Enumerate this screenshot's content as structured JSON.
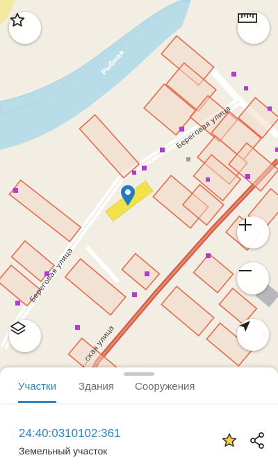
{
  "map": {
    "river_name": "Рыбная",
    "street_labels": [
      "Береговая улица",
      "Береговая улица",
      "…ская улица"
    ],
    "colors": {
      "background": "#f3eee4",
      "river": "#b8dde9",
      "parcel_stroke": "#e86a4d",
      "parcel_fill": "#f2d6c4",
      "selected_parcel": "#f1e24a",
      "building_marker": "#b43bd0",
      "pin": "#1f7ec2"
    }
  },
  "controls": {
    "favorite_icon": "star-icon",
    "ruler_icon": "ruler-icon",
    "zoom_in_icon": "plus-icon",
    "zoom_out_icon": "minus-icon",
    "layers_icon": "layers-icon",
    "locate_icon": "navigation-arrow-icon"
  },
  "panel": {
    "tabs": [
      {
        "label": "Участки",
        "active": true
      },
      {
        "label": "Здания",
        "active": false
      },
      {
        "label": "Сооружения",
        "active": false
      }
    ],
    "parcel": {
      "cadastral_number": "24:40:0310102:361",
      "type": "Земельный участок"
    },
    "actions": {
      "favorite_icon": "star-icon",
      "share_icon": "share-icon"
    },
    "accent_color": "#2a86c9"
  }
}
